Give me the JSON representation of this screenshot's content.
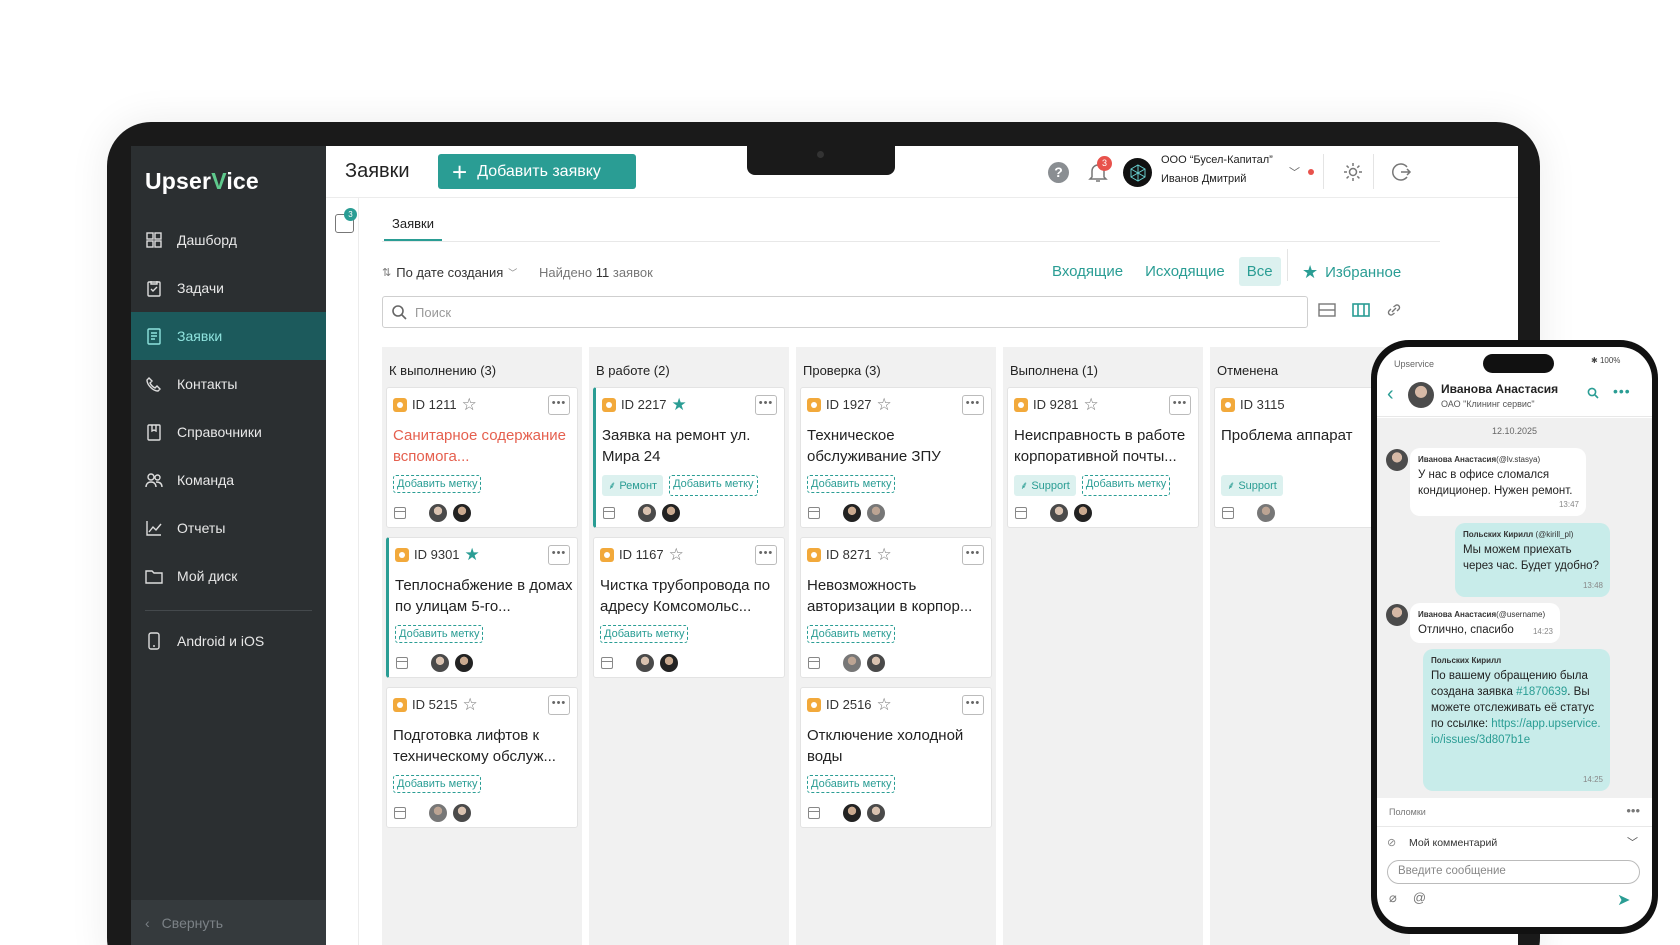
{
  "app": {
    "logo_pre": "Upser",
    "logo_v": "V",
    "logo_post": "ice"
  },
  "sidebar": {
    "items": [
      {
        "label": "Дашборд",
        "icon": "dashboard-icon"
      },
      {
        "label": "Задачи",
        "icon": "tasks-icon"
      },
      {
        "label": "Заявки",
        "icon": "requests-icon",
        "active": true
      },
      {
        "label": "Контакты",
        "icon": "contacts-icon"
      },
      {
        "label": "Справочники",
        "icon": "reference-icon"
      },
      {
        "label": "Команда",
        "icon": "team-icon"
      },
      {
        "label": "Отчеты",
        "icon": "reports-icon"
      },
      {
        "label": "Мой диск",
        "icon": "folder-icon"
      }
    ],
    "mobile_label": "Android и iOS",
    "collapse_label": "Свернуть"
  },
  "header": {
    "title": "Заявки",
    "add_button": "Добавить заявку",
    "help": "?",
    "notifications_count": "3",
    "org_name": "ООО “Бусел-Капитал”",
    "user_name": "Иванов Дмитрий"
  },
  "filters": {
    "badge": "3",
    "tab": "Заявки",
    "sort_label": "По дате создания",
    "found_prefix": "Найдено",
    "found_count": "11",
    "found_suffix": "заявок",
    "incoming": "Входящие",
    "outgoing": "Исходящие",
    "all": "Все",
    "favorites": "Избранное",
    "search_placeholder": "Поиск"
  },
  "columns": [
    {
      "title": "К выполнению (3)",
      "cards": [
        {
          "id": "ID 1211",
          "title": "Санитарное содержание вспомога...",
          "title_red": true,
          "tag": "",
          "tag_add": "Добавить метку",
          "starred": false
        },
        {
          "id": "ID 9301",
          "title": "Теплоснабжение в домах по улицам 5-го...",
          "tag": "",
          "tag_add": "Добавить метку",
          "starred": true
        },
        {
          "id": "ID 5215",
          "title": "Подготовка лифтов к техническому обслуж...",
          "tag": "",
          "tag_add": "Добавить метку",
          "starred": false
        }
      ]
    },
    {
      "title": "В работе (2)",
      "cards": [
        {
          "id": "ID 2217",
          "title": "Заявка на ремонт ул. Мира 24",
          "tag": "Ремонт",
          "tag_add": "Добавить метку",
          "starred": true
        },
        {
          "id": "ID 1167",
          "title": "Чистка трубопровода по адресу Комсомольс...",
          "tag": "",
          "tag_add": "Добавить метку",
          "starred": false
        }
      ]
    },
    {
      "title": "Проверка (3)",
      "cards": [
        {
          "id": "ID 1927",
          "title": "Техническое обслуживание ЗПУ",
          "tag": "",
          "tag_add": "Добавить метку",
          "starred": false
        },
        {
          "id": "ID 8271",
          "title": "Невозможность авторизации в корпор...",
          "tag": "",
          "tag_add": "Добавить метку",
          "starred": false
        },
        {
          "id": "ID 2516",
          "title": "Отключение холодной воды",
          "tag": "",
          "tag_add": "Добавить метку",
          "starred": false
        }
      ]
    },
    {
      "title": "Выполнена (1)",
      "cards": [
        {
          "id": "ID 9281",
          "title": "Неисправность в работе корпоративной почты...",
          "tag": "Support",
          "tag_add": "Добавить метку",
          "starred": false
        }
      ]
    },
    {
      "title": "Отменена",
      "cards": [
        {
          "id": "ID 3115",
          "title": "Проблема аппарат",
          "tag": "Support",
          "tag_add": "",
          "starred": false
        }
      ]
    }
  ],
  "phone": {
    "status_app": "Upservice",
    "battery": "100%",
    "contact_name": "Иванова Анастасия",
    "contact_org": "ОАО \"Клининг сервис\"",
    "date": "12.10.2025",
    "messages": [
      {
        "author": "Иванова Анастасия",
        "handle": "(@lv.stasya)",
        "text": "У нас в офисе сломался кондиционер. Нужен ремонт.",
        "time": "13:47"
      },
      {
        "author": "Польских Кирилл",
        "handle": "(@kirill_pl)",
        "text": "Мы можем приехать через час. Будет удобно?",
        "time": "13:48"
      },
      {
        "author": "Иванова Анастасия",
        "handle": "(@username)",
        "text": "Отлично, спасибо",
        "time": "14:23"
      },
      {
        "author": "Польских Кирилл",
        "handle": "",
        "text_1": "По вашему обращению была создана заявка",
        "link_1": "#1870639",
        "text_2": ". Вы можете отслеживать её статус по ссылке:",
        "link_2": "https://app.upservice.io/issues/3d807b1e",
        "time": "14:25"
      }
    ],
    "breakdown_label": "Поломки",
    "comment_label": "Мой комментарий",
    "input_placeholder": "Введите сообщение"
  }
}
